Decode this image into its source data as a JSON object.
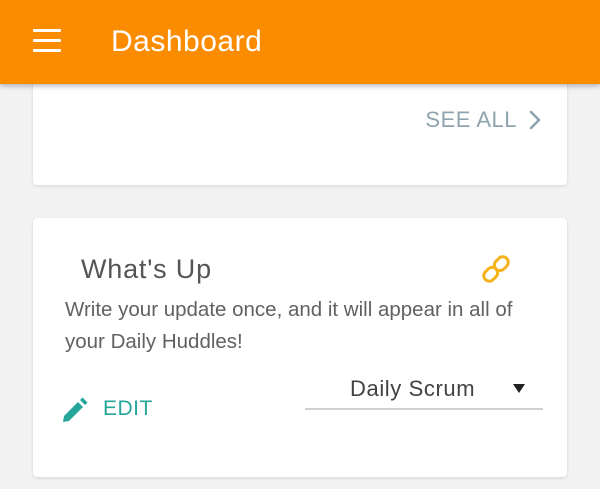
{
  "app_bar": {
    "title": "Dashboard",
    "menu_icon": "hamburger-menu-icon",
    "background": "#fb8c00"
  },
  "top_card": {
    "see_all_label": "SEE ALL",
    "see_all_icon": "chevron-right-icon"
  },
  "whats_up": {
    "title": "What's Up",
    "link_icon": "link-icon",
    "description": "Write your update once, and it will appear in all of your Daily Huddles!",
    "edit_label": "EDIT",
    "edit_icon": "pencil-icon",
    "huddle_select": {
      "selected": "Daily Scrum",
      "icon": "caret-down-icon"
    }
  },
  "colors": {
    "accent": "#fb8c00",
    "link": "#f6b21b",
    "edit": "#26a69a",
    "see_all": "#90a4ae"
  }
}
